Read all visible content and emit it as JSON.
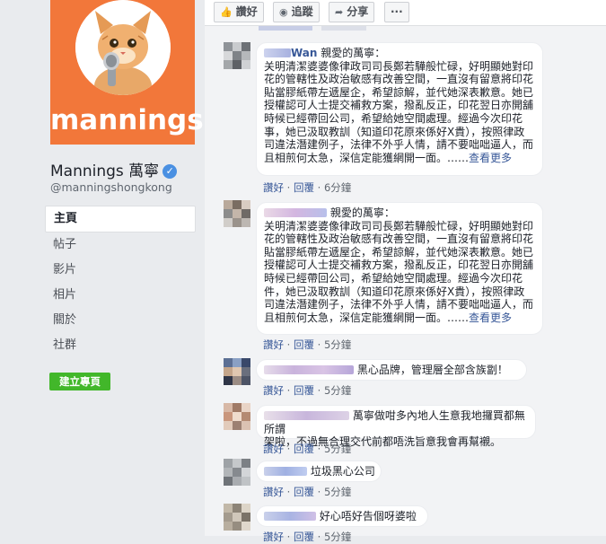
{
  "page": {
    "logo_text": "mannings",
    "name": "Mannings 萬寧",
    "handle": "@manningshongkong",
    "nav": [
      "主頁",
      "帖子",
      "影片",
      "相片",
      "關於",
      "社群"
    ],
    "create_page_label": "建立專頁"
  },
  "actions": {
    "like": "讚好",
    "follow": "追蹤",
    "share": "分享",
    "more": "···"
  },
  "comments": [
    {
      "name": "Wan",
      "text_lines": [
        "親愛的萬寧：",
        "关明清潔婆婆像律政司司長鄭若驊般忙碌，好明顯她對印",
        "花的管轄性及政治敏感有改善空間，一直沒有留意將印花",
        "貼當膠紙帶左遞屋企，希望諒解，並代她深表歉意。她已",
        "授權認可人士提交補救方案，撥亂反正，印花翌日亦開舖",
        "時候已經帶回公司，希望給她空間處理。經過今次印花",
        "事，她已汲取教訓（知道印花原來係好X貴），按照律政",
        "司違法潛建例子，法律不外乎人情，請不要咄咄逼人，而",
        "且相煎何太急，深信定能獲網開一面。"
      ],
      "ellipsis": "……",
      "see_more": "查看更多",
      "like": "讚好",
      "reply": "回覆",
      "time": "6分鐘"
    },
    {
      "name": "",
      "text_lines": [
        "親愛的萬寧：",
        "关明清潔婆婆像律政司司長鄭若驊般忙碌，好明顯她對印",
        "花的管轄性及政治敏感有改善空間，一直沒有留意將印花",
        "貼當膠紙帶左遞屋企，希望諒解，並代她深表歉意。她已",
        "授權認可人士提交補救方案，撥亂反正，印花翌日亦開舖",
        "時候已經帶回公司，希望給她空間處理。經過今次印花",
        "件，她已汲取教訓（知道印花原來係好X貴），按照律政",
        "司違法潛建例子，法律不外乎人情，請不要咄咄逼人，而",
        "且相煎何太急，深信定能獲網開一面。"
      ],
      "ellipsis": "……",
      "see_more": "查看更多",
      "like": "讚好",
      "reply": "回覆",
      "time": "5分鐘"
    },
    {
      "text": "黑心品牌，管理層全部含族劏！",
      "like": "讚好",
      "reply": "回覆",
      "time": "5分鐘"
    },
    {
      "text_lines": [
        "萬寧做咁多內地人生意我地攞買都無所謂",
        "架啦，不過無合理交代前都唔洗旨意我會再幫襯。"
      ],
      "like": "讚好",
      "reply": "回覆",
      "time": "5分鐘"
    },
    {
      "text": "垃圾黑心公司",
      "like": "讚好",
      "reply": "回覆",
      "time": "5分鐘"
    },
    {
      "text": "好心唔好告個呀婆啦",
      "like": "讚好",
      "reply": "回覆",
      "time": "5分鐘"
    }
  ],
  "colors": {
    "brand_orange": "#f2773a",
    "link_blue": "#385898",
    "verified_blue": "#4a90e2",
    "create_green": "#42b72a"
  },
  "icons": [
    "like-icon",
    "rss-icon",
    "share-icon",
    "verified-icon",
    "cat-logo-icon"
  ]
}
